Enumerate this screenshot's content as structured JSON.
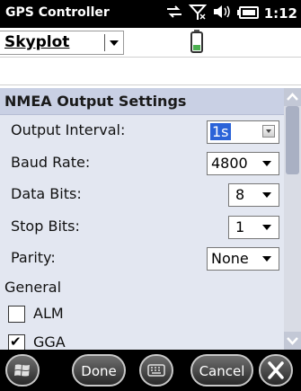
{
  "status_bar": {
    "app_title": "GPS Controller",
    "time": "1:12",
    "icons": [
      "connectivity-icon",
      "signal-off-icon",
      "volume-icon",
      "battery-icon"
    ]
  },
  "top_bar": {
    "menu_label": "Skyplot",
    "icon": "battery-level-icon"
  },
  "input_field": {
    "value": ""
  },
  "settings": {
    "section_title": "NMEA Output Settings",
    "rows": [
      {
        "label": "Output Interval:",
        "value": "1s"
      },
      {
        "label": "Baud Rate:",
        "value": "4800"
      },
      {
        "label": "Data Bits:",
        "value": "8"
      },
      {
        "label": "Stop Bits:",
        "value": "1"
      },
      {
        "label": "Parity:",
        "value": "None"
      }
    ],
    "group_label": "General",
    "checkboxes": [
      {
        "label": "ALM",
        "checked": false
      },
      {
        "label": "GGA",
        "checked": true
      }
    ]
  },
  "bottom_bar": {
    "start_icon": "windows-start-icon",
    "done_label": "Done",
    "keyboard_icon": "keyboard-icon",
    "cancel_label": "Cancel",
    "close_icon": "close-icon"
  },
  "colors": {
    "panel_bg": "#e3e7f1",
    "header_bg": "#c9d0e4",
    "selection": "#2b63d8"
  }
}
